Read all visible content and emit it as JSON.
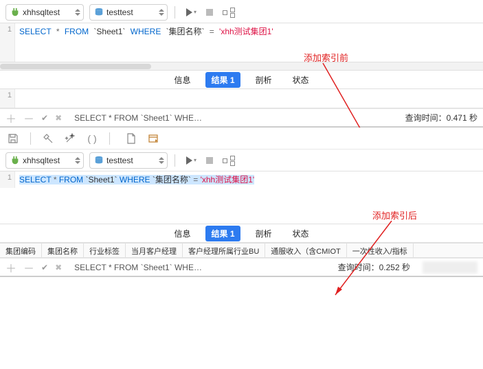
{
  "panel1": {
    "connection": "xhhsqltest",
    "database": "testtest",
    "line_no": "1",
    "sql": {
      "select": "SELECT",
      "star": "*",
      "from": "FROM",
      "table": "`Sheet1`",
      "where": "WHERE",
      "col": "`集团名称`",
      "eq": "=",
      "val": "'xhh测试集团1'"
    },
    "tabs": {
      "info": "信息",
      "result": "结果 1",
      "profile": "剖析",
      "state": "状态"
    },
    "result_row": "1",
    "status_query": "SELECT * FROM `Sheet1` WHE…",
    "status_time_label": "查询时间：",
    "status_time_val": "0.471 秒",
    "annot": "添加索引前"
  },
  "panel2": {
    "connection": "xhhsqltest",
    "database": "testtest",
    "line_no": "1",
    "sql": {
      "select": "SELECT",
      "star": "*",
      "from": "FROM",
      "table": "`Sheet1`",
      "where": "WHERE",
      "col": "`集团名称`",
      "eq": "=",
      "val": "'xhh测试集团1'"
    },
    "tabs": {
      "info": "信息",
      "result": "结果 1",
      "profile": "剖析",
      "state": "状态"
    },
    "columns": [
      "集团编码",
      "集团名称",
      "行业标签",
      "当月客户经理",
      "客户经理所属行业BU",
      "通服收入（含CMIOT",
      "一次性收入/指标"
    ],
    "status_query": "SELECT * FROM `Sheet1` WHE…",
    "status_time_label": "查询时间：",
    "status_time_val": "0.252 秒",
    "annot": "添加索引后"
  }
}
